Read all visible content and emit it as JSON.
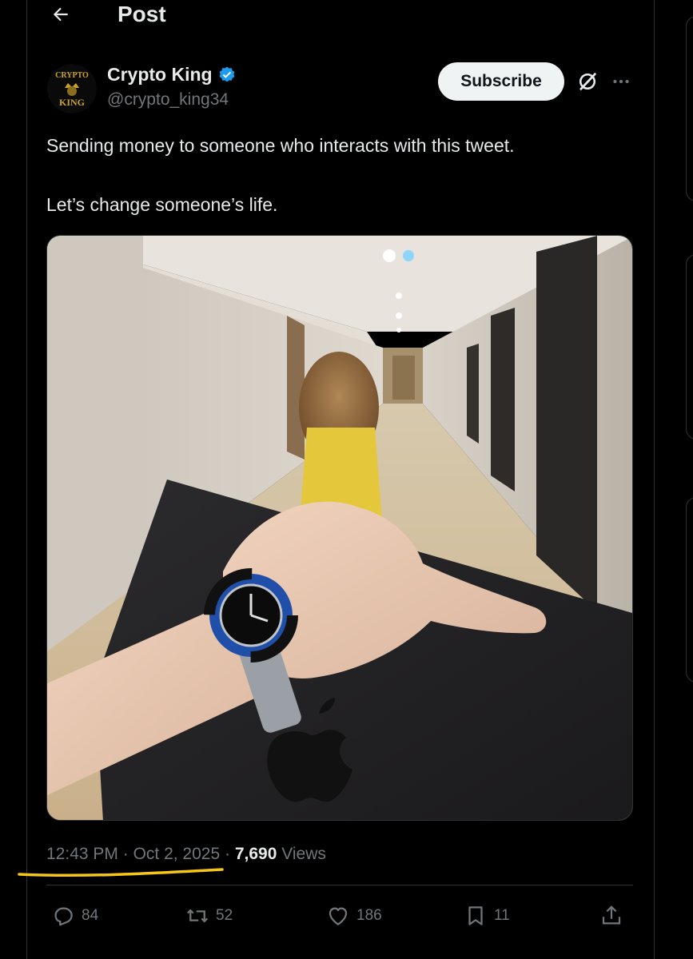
{
  "header": {
    "title": "Post",
    "back_icon": "arrow-left-icon"
  },
  "author": {
    "name": "Crypto King",
    "handle": "@crypto_king34",
    "verified": true,
    "verified_color": "#1d9bf0",
    "avatar_text_top": "CRYPTO",
    "avatar_text_bottom": "KING",
    "avatar_accent": "#c9a227"
  },
  "actions_top": {
    "subscribe_label": "Subscribe",
    "grok_icon": "grok-icon",
    "more_icon": "more-horizontal-icon"
  },
  "tweet": {
    "paragraphs": [
      "Sending money to someone who interacts with this tweet.",
      "Let’s change someone’s life."
    ]
  },
  "media": {
    "type": "photo",
    "subject": "wrist with watch, laptop, hallway"
  },
  "meta": {
    "time": "12:43 PM",
    "sep1": "·",
    "date": "Oct 2, 2025",
    "sep2": "·",
    "views_count": "7,690",
    "views_label": "Views",
    "highlight_color": "#f5c518"
  },
  "engagement": {
    "replies": "84",
    "reposts": "52",
    "likes": "186",
    "bookmarks": "11"
  },
  "colors": {
    "background": "#000000",
    "text": "#e7e9ea",
    "muted": "#71767b",
    "border": "#2f3336"
  }
}
